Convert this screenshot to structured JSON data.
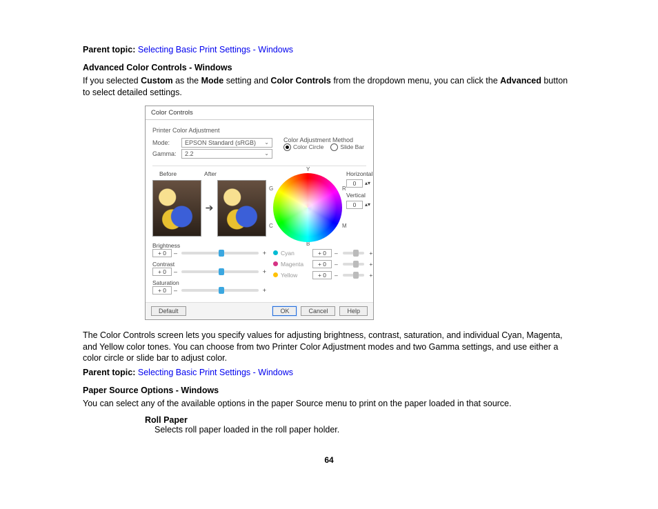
{
  "page_number": "64",
  "parent_topic_label": "Parent topic:",
  "parent_topic_link": "Selecting Basic Print Settings - Windows",
  "section1": {
    "heading": "Advanced Color Controls - Windows",
    "intro_pre": "If you selected ",
    "intro_b1": "Custom",
    "intro_mid1": " as the ",
    "intro_b2": "Mode",
    "intro_mid2": " setting and ",
    "intro_b3": "Color Controls",
    "intro_mid3": " from the dropdown menu, you can click the ",
    "intro_b4": "Advanced",
    "intro_end": " button to select detailed settings.",
    "after_image": "The Color Controls screen lets you specify values for adjusting brightness, contrast, saturation, and individual Cyan, Magenta, and Yellow color tones. You can choose from two Printer Color Adjustment modes and two Gamma settings, and use either a color circle or slide bar to adjust color."
  },
  "section2": {
    "heading": "Paper Source Options - Windows",
    "intro": "You can select any of the available options in the paper Source menu to print on the paper loaded in that source.",
    "item_term": "Roll Paper",
    "item_def": "Selects roll paper loaded in the roll paper holder."
  },
  "dialog": {
    "title": "Color Controls",
    "group1": "Printer Color Adjustment",
    "mode_label": "Mode:",
    "mode_value": "EPSON Standard (sRGB)",
    "gamma_label": "Gamma:",
    "gamma_value": "2.2",
    "before": "Before",
    "after": "After",
    "brightness": "Brightness",
    "contrast": "Contrast",
    "saturation": "Saturation",
    "spin_zero": "+ 0",
    "adj_method": "Color Adjustment Method",
    "radio1": "Color Circle",
    "radio2": "Slide Bar",
    "axes_h": "Horizontal",
    "axes_v": "Vertical",
    "axes_val": "0",
    "wheel_Y": "Y",
    "wheel_R": "R",
    "wheel_M": "M",
    "wheel_B": "B",
    "wheel_C": "C",
    "wheel_G": "G",
    "cyan": "Cyan",
    "magenta": "Magenta",
    "yellow": "Yellow",
    "cval": "+ 0",
    "btn_default": "Default",
    "btn_ok": "OK",
    "btn_cancel": "Cancel",
    "btn_help": "Help"
  }
}
